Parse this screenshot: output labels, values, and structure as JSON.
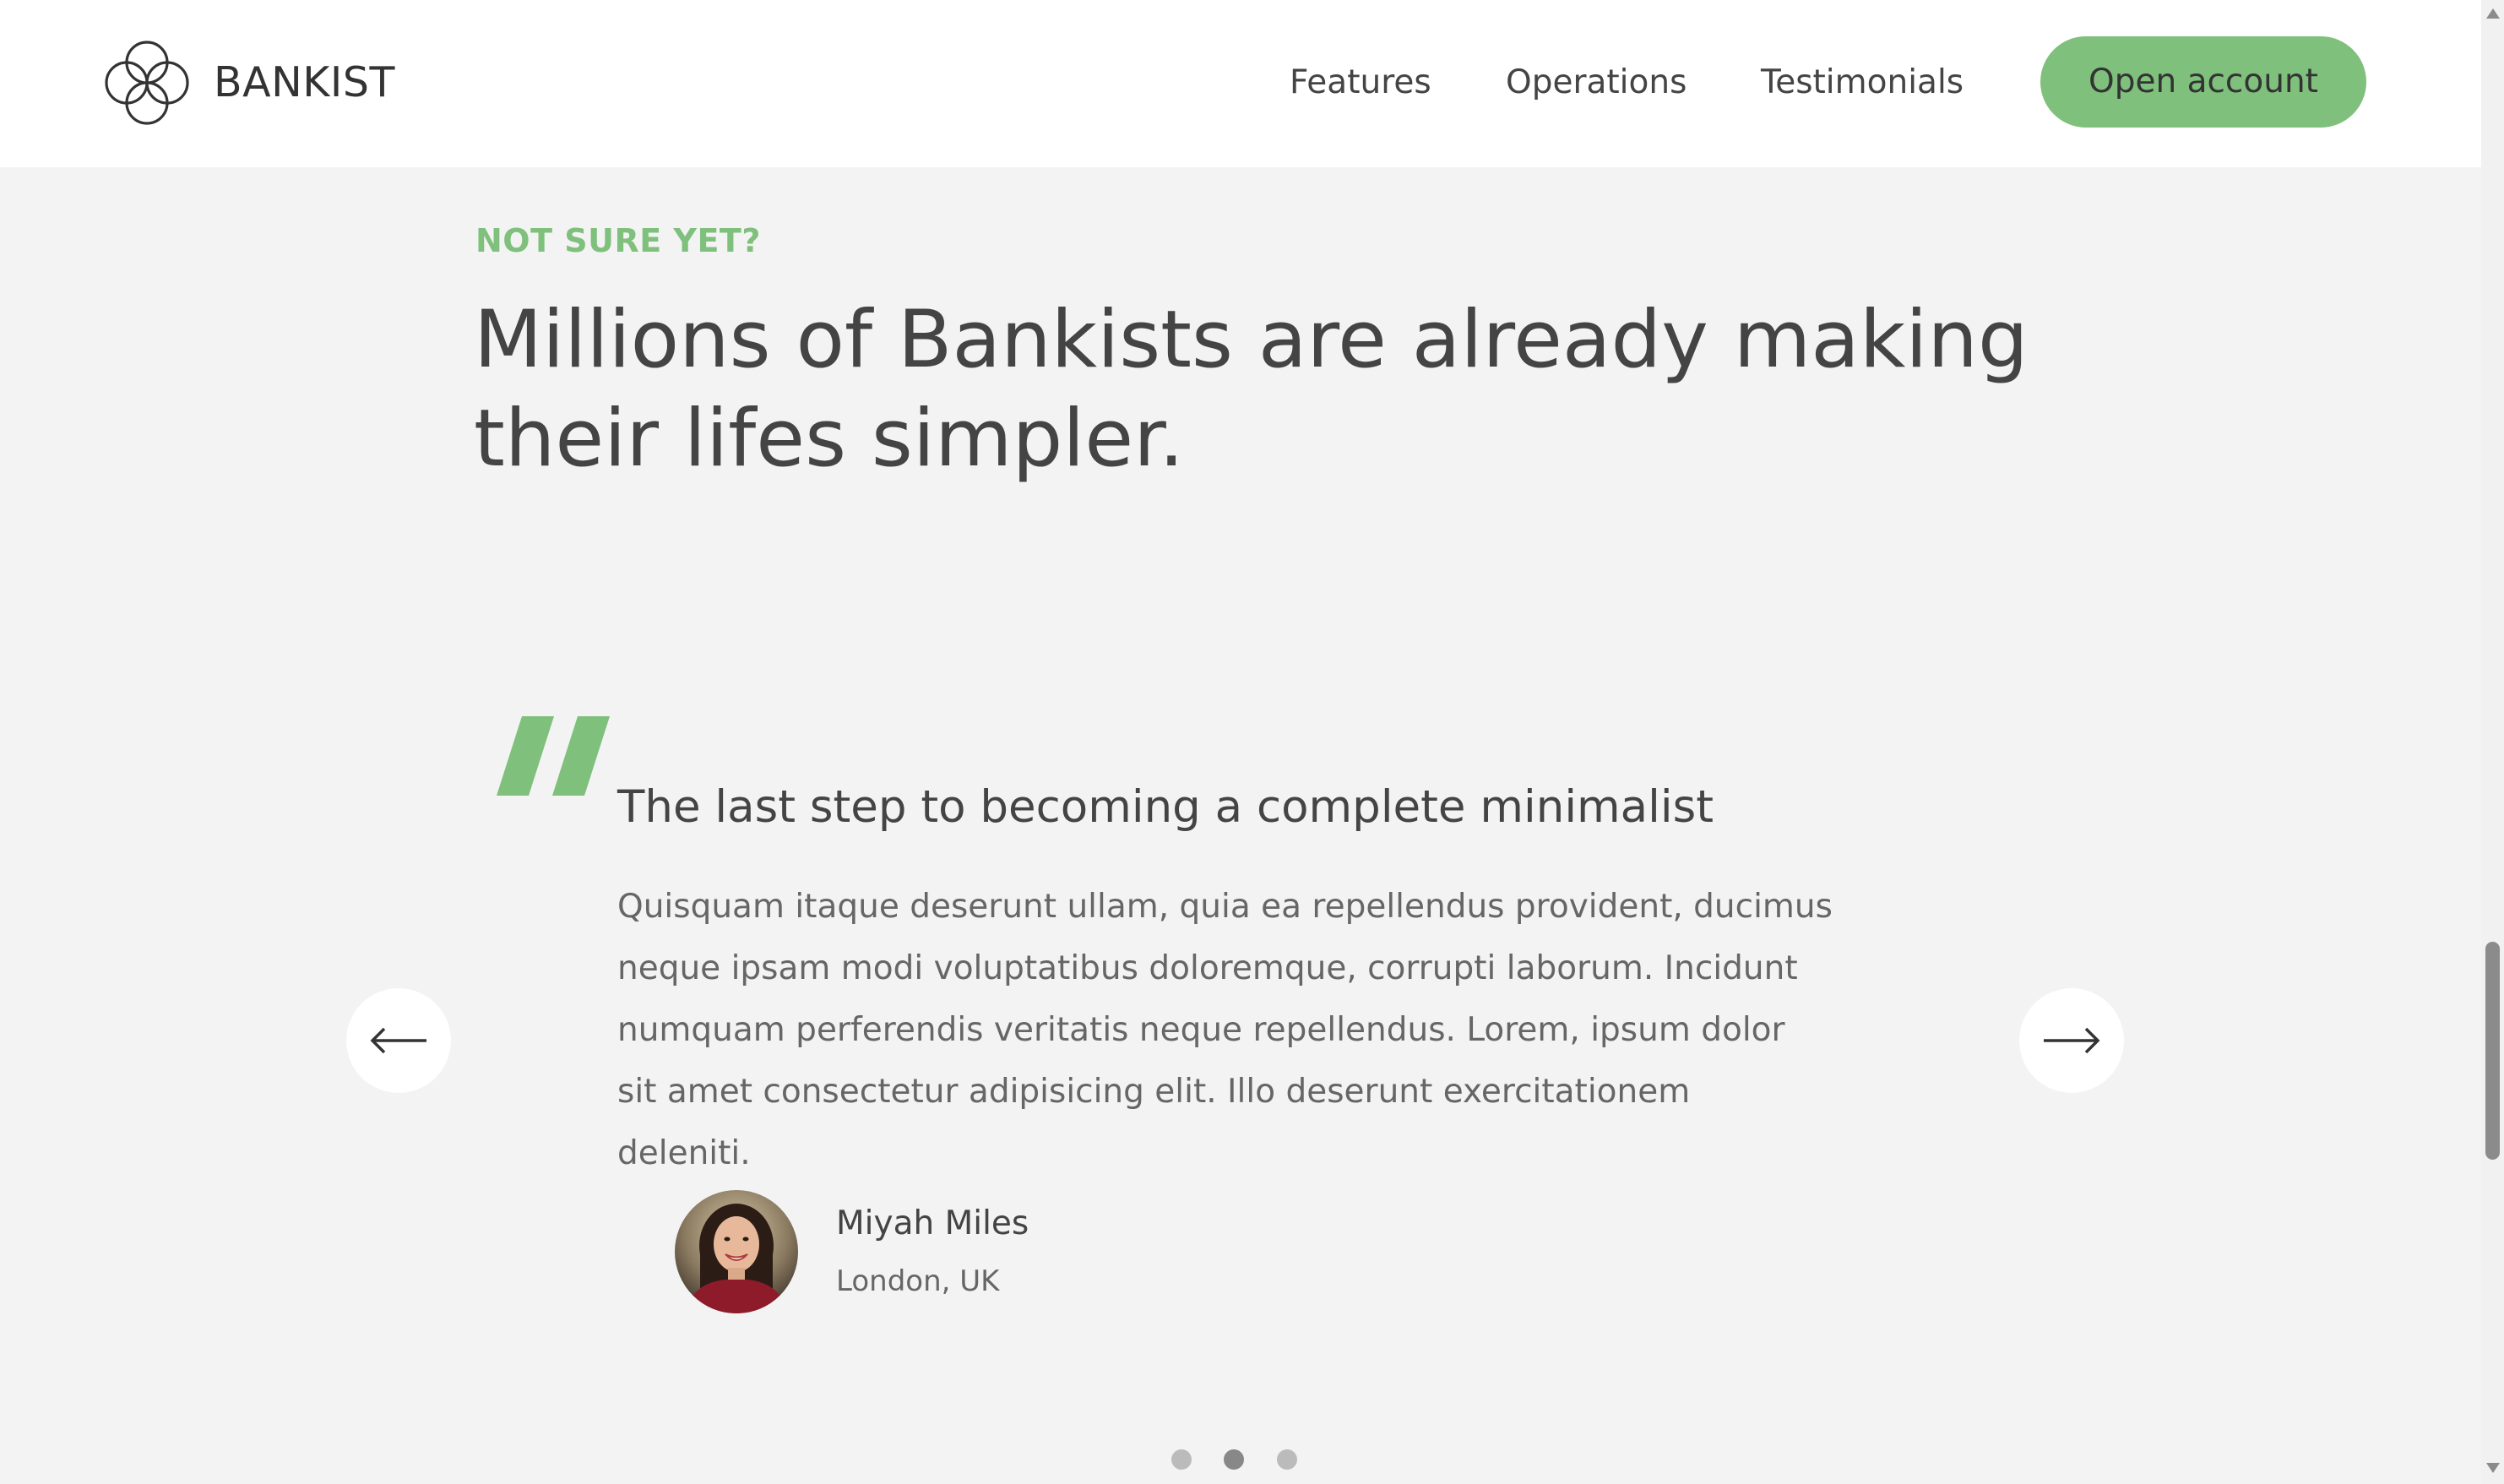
{
  "colors": {
    "accent": "#7fc07c",
    "background": "#f3f3f3",
    "header_background": "#ffffff",
    "text_dark": "#444444",
    "text_muted": "#666666"
  },
  "header": {
    "brand": "BANKIST",
    "logo_icon": "four-ring-flower-logo",
    "nav": [
      {
        "label": "Features"
      },
      {
        "label": "Operations"
      },
      {
        "label": "Testimonials"
      }
    ],
    "cta_label": "Open account"
  },
  "section": {
    "eyebrow": "NOT SURE YET?",
    "headline": "Millions of Bankists are already making their lifes simpler."
  },
  "testimonial": {
    "quote_icon": "quote-mark-icon",
    "title": "The last step to becoming a complete minimalist",
    "body": "Quisquam itaque deserunt ullam, quia ea repellendus provident, ducimus neque ipsam modi voluptatibus doloremque, corrupti laborum. Incidunt numquam perferendis veritatis neque repellendus. Lorem, ipsum dolor sit amet consectetur adipisicing elit. Illo deserunt exercitationem deleniti.",
    "author_name": "Miyah Miles",
    "author_location": "London, UK"
  },
  "slider": {
    "prev_icon": "arrow-left-icon",
    "next_icon": "arrow-right-icon",
    "dots_total": 3,
    "active_dot": 2
  }
}
